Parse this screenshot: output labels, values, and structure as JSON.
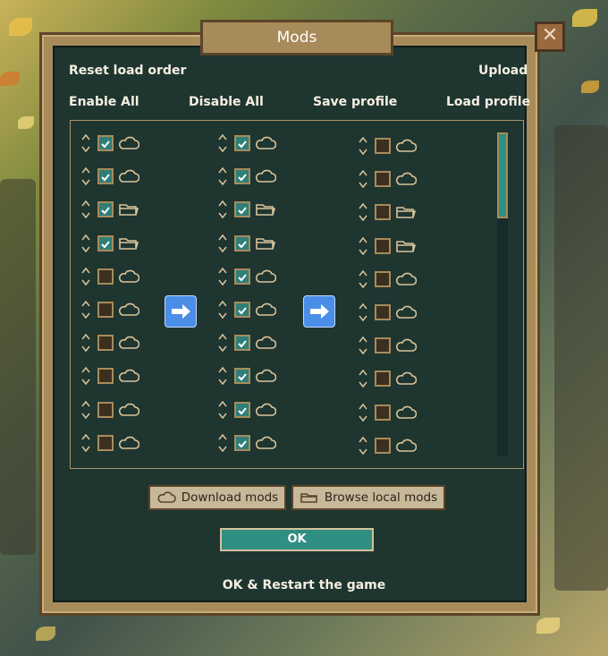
{
  "title": "Mods",
  "links": {
    "reset_load_order": "Reset load order",
    "upload": "Upload",
    "enable_all": "Enable All",
    "disable_all": "Disable All",
    "save_profile": "Save profile",
    "load_profile": "Load profile"
  },
  "columns": [
    {
      "rows": [
        {
          "checked": true,
          "source": "cloud"
        },
        {
          "checked": true,
          "source": "cloud"
        },
        {
          "checked": true,
          "source": "folder"
        },
        {
          "checked": true,
          "source": "folder"
        },
        {
          "checked": false,
          "source": "cloud"
        },
        {
          "checked": false,
          "source": "cloud"
        },
        {
          "checked": false,
          "source": "cloud"
        },
        {
          "checked": false,
          "source": "cloud"
        },
        {
          "checked": false,
          "source": "cloud"
        },
        {
          "checked": false,
          "source": "cloud"
        }
      ]
    },
    {
      "rows": [
        {
          "checked": true,
          "source": "cloud"
        },
        {
          "checked": true,
          "source": "cloud"
        },
        {
          "checked": true,
          "source": "folder"
        },
        {
          "checked": true,
          "source": "folder"
        },
        {
          "checked": true,
          "source": "cloud"
        },
        {
          "checked": true,
          "source": "cloud"
        },
        {
          "checked": true,
          "source": "cloud"
        },
        {
          "checked": true,
          "source": "cloud"
        },
        {
          "checked": true,
          "source": "cloud"
        },
        {
          "checked": true,
          "source": "cloud"
        }
      ]
    },
    {
      "rows": [
        {
          "checked": false,
          "source": "cloud"
        },
        {
          "checked": false,
          "source": "cloud"
        },
        {
          "checked": false,
          "source": "folder"
        },
        {
          "checked": false,
          "source": "folder"
        },
        {
          "checked": false,
          "source": "cloud"
        },
        {
          "checked": false,
          "source": "cloud"
        },
        {
          "checked": false,
          "source": "cloud"
        },
        {
          "checked": false,
          "source": "cloud"
        },
        {
          "checked": false,
          "source": "cloud"
        },
        {
          "checked": false,
          "source": "cloud"
        }
      ]
    }
  ],
  "buttons": {
    "download_mods": "Download mods",
    "browse_local_mods": "Browse local mods",
    "ok": "OK",
    "ok_restart": "OK & Restart the game"
  },
  "colors": {
    "panel": "#1f3530",
    "frame": "#a88b5a",
    "accent_teal": "#2f8f82",
    "arrow_blue": "#4a8ee8"
  }
}
